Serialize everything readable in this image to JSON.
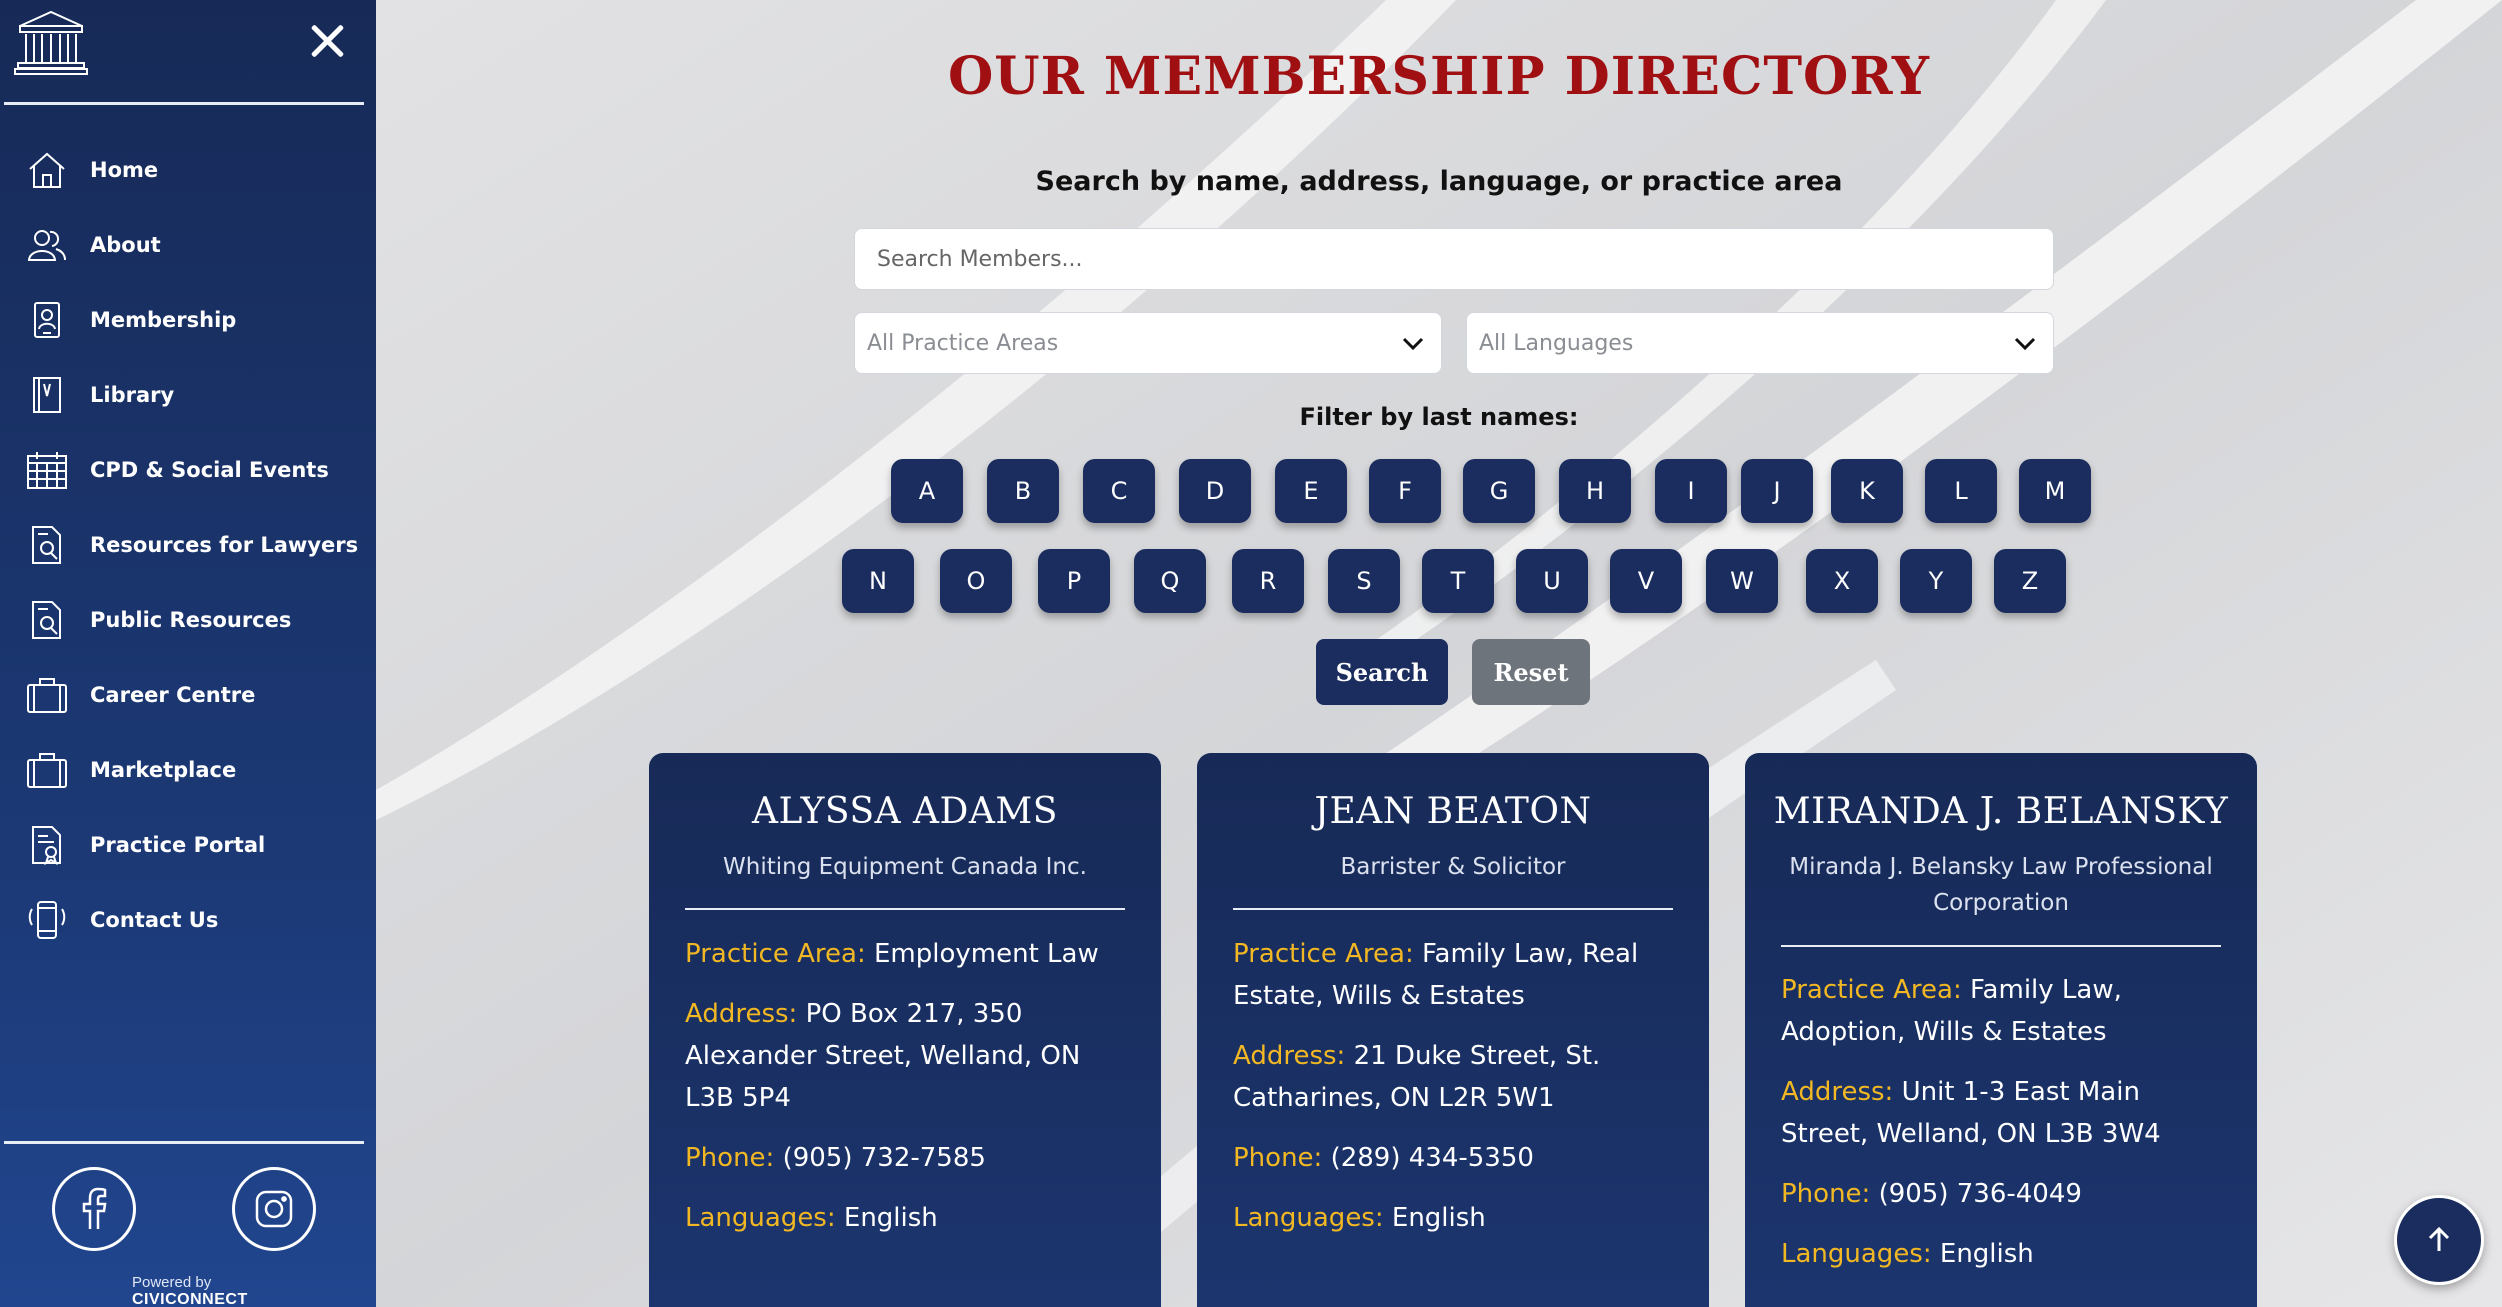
{
  "sidebar": {
    "logo_icon": "courthouse-icon",
    "close_icon": "close-icon",
    "items": [
      {
        "label": "Home",
        "icon": "home-icon"
      },
      {
        "label": "About",
        "icon": "people-icon"
      },
      {
        "label": "Membership",
        "icon": "id-badge-icon"
      },
      {
        "label": "Library",
        "icon": "book-icon"
      },
      {
        "label": "CPD & Social Events",
        "icon": "calendar-icon"
      },
      {
        "label": "Resources for Lawyers",
        "icon": "document-search-icon"
      },
      {
        "label": "Public Resources",
        "icon": "document-search-icon"
      },
      {
        "label": "Career Centre",
        "icon": "briefcase-icon"
      },
      {
        "label": "Marketplace",
        "icon": "briefcase-icon"
      },
      {
        "label": "Practice Portal",
        "icon": "document-icon"
      },
      {
        "label": "Contact Us",
        "icon": "phone-icon"
      }
    ],
    "social": [
      {
        "icon": "facebook-icon"
      },
      {
        "icon": "instagram-icon"
      }
    ],
    "powered_by": "Powered by",
    "brand": "CIVICONNECT"
  },
  "main": {
    "title": "OUR MEMBERSHIP DIRECTORY",
    "subtitle": "Search by name, address, language, or practice area",
    "search_placeholder": "Search Members...",
    "practice_select": "All Practice Areas",
    "language_select": "All Languages",
    "filter_label": "Filter by last names:",
    "letters_row1": [
      "A",
      "B",
      "C",
      "D",
      "E",
      "F",
      "G",
      "H",
      "I",
      "J",
      "K",
      "L",
      "M"
    ],
    "letters_row2": [
      "N",
      "O",
      "P",
      "Q",
      "R",
      "S",
      "T",
      "U",
      "V",
      "W",
      "X",
      "Y",
      "Z"
    ],
    "search_button": "Search",
    "reset_button": "Reset"
  },
  "field_labels": {
    "practice": "Practice Area:",
    "address": "Address:",
    "phone": "Phone:",
    "languages": "Languages:"
  },
  "members": [
    {
      "name": "ALYSSA ADAMS",
      "firm": "Whiting Equipment Canada Inc.",
      "practice": "Employment Law",
      "address": "PO Box 217, 350 Alexander Street, Welland, ON L3B 5P4",
      "phone": "(905) 732-7585",
      "languages": "English"
    },
    {
      "name": "JEAN BEATON",
      "firm": "Barrister & Solicitor",
      "practice": "Family Law, Real Estate, Wills & Estates",
      "address": "21 Duke Street, St. Catharines, ON L2R 5W1",
      "phone": "(289) 434-5350",
      "languages": "English"
    },
    {
      "name": "MIRANDA J. BELANSKY",
      "firm": "Miranda J. Belansky Law Professional Corporation",
      "practice": "Family Law, Adoption, Wills & Estates",
      "address": "Unit 1-3 East Main Street, Welland, ON L3B 3W4",
      "phone": "(905) 736-4049",
      "languages": "English"
    }
  ],
  "back_to_top_icon": "arrow-up-icon",
  "colors": {
    "navy": "#1a2d5e",
    "title_red": "#a00f12",
    "label_gold": "#f2b823",
    "reset_gray": "#6e747c"
  }
}
